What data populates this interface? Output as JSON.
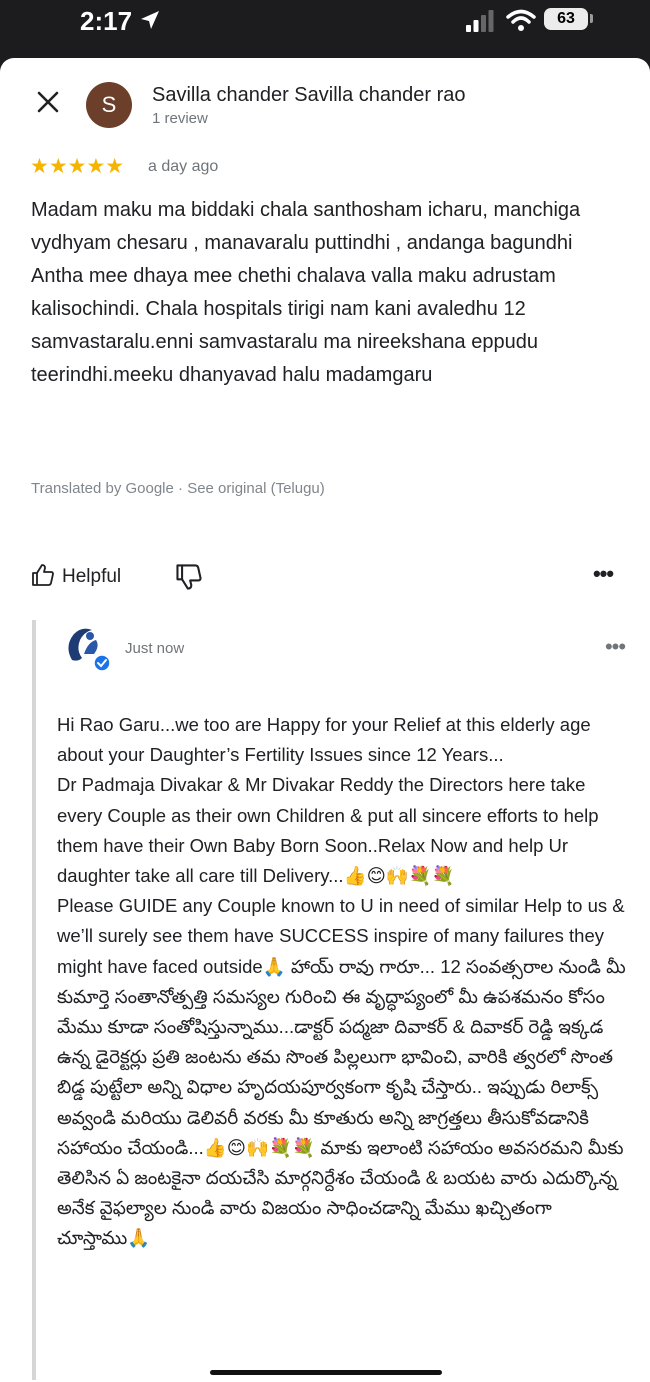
{
  "status_bar": {
    "time": "2:17",
    "battery": "63",
    "location_icon": "location-arrow-icon",
    "signal_icon": "cellular-signal-icon",
    "wifi_icon": "wifi-icon"
  },
  "review": {
    "reviewer_name": "Savilla chander Savilla chander rao",
    "reviewer_initial": "S",
    "reviewer_meta": "1 review",
    "stars": "★★★★★",
    "rating": 5,
    "time": "a day ago",
    "paragraphs": [
      "Madam maku ma biddaki chala santhosham icharu, manchiga vydhyam chesaru , manavaralu puttindhi , andanga bagundhi",
      "Antha mee dhaya mee chethi chalava valla maku adrustam kalisochindi. Chala hospitals tirigi nam kani avaledhu 12 samvastaralu.enni samvastaralu ma nireekshana eppudu teerindhi.meeku dhanyavad halu madamgaru"
    ],
    "translated_note": "Translated by Google · See original (Telugu)",
    "helpful_label": "Helpful"
  },
  "reply": {
    "time": "Just now",
    "paragraphs": [
      " Hi Rao Garu...we too are Happy for your Relief at this elderly age about your Daughter’s Fertility Issues since 12 Years...",
      "Dr Padmaja Divakar & Mr Divakar Reddy the Directors here take every Couple as their own Children & put all sincere efforts to help them have their Own Baby Born Soon..Relax Now and help Ur daughter take all care till Delivery...👍😊🙌💐💐",
      "Please GUIDE any Couple known to U in need of similar Help to us & we’ll surely see them have SUCCESS inspire of many failures they might have faced outside🙏 హాయ్ రావు గారూ... 12 సంవత్సరాల నుండి మీ కుమార్తె సంతానోత్పత్తి సమస్యల గురించి ఈ వృద్ధాప్యంలో మీ ఉపశమనం కోసం మేము కూడా సంతోషిస్తున్నాము...డాక్టర్ పద్మజా దివాకర్ & దివాకర్ రెడ్డి ఇక్కడ ఉన్న డైరెక్టర్లు ప్రతి జంటను తమ సొంత పిల్లలుగా భావించి, వారికి త్వరలో సొంత బిడ్డ పుట్టేలా అన్ని విధాల హృదయపూర్వకంగా కృషి చేస్తారు.. ఇప్పుడు రిలాక్స్ అవ్వండి మరియు డెలివరీ వరకు మీ కూతురు అన్ని జాగ్రత్తలు తీసుకోవడానికి సహాయం చేయండి...👍😊🙌💐💐 మాకు ఇలాంటి సహాయం అవసరమని మీకు తెలిసిన ఏ జంటకైనా దయచేసి మార్గనిర్దేశం చేయండి & బయట వారు ఎదుర్కొన్న అనేక వైఫల్యాల నుండి వారు విజయం సాధించడాన్ని మేము ఖచ్చితంగా చూస్తాము🙏"
    ]
  },
  "colors": {
    "star": "#f4b400",
    "avatar_bg": "#6b3f2a",
    "verified": "#1a73e8",
    "muted_text": "#70757a"
  }
}
